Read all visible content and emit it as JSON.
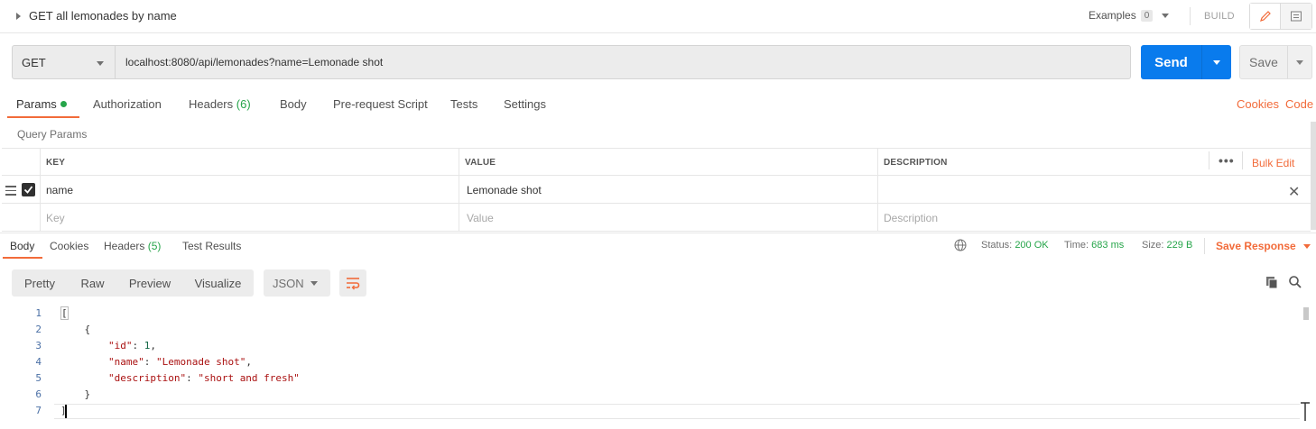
{
  "request": {
    "title": "GET all lemonades by name",
    "examples_label": "Examples",
    "examples_count": "0",
    "build_label": "BUILD",
    "method": "GET",
    "url": "localhost:8080/api/lemonades?name=Lemonade shot",
    "send_label": "Send",
    "save_label": "Save"
  },
  "request_tabs": {
    "params": "Params",
    "authorization": "Authorization",
    "headers": "Headers",
    "headers_count": "(6)",
    "body": "Body",
    "pre_request": "Pre-request Script",
    "tests": "Tests",
    "settings": "Settings",
    "cookies": "Cookies",
    "code": "Code"
  },
  "query_params": {
    "title": "Query Params",
    "columns": [
      "KEY",
      "VALUE",
      "DESCRIPTION"
    ],
    "bulk_edit": "Bulk Edit",
    "rows": [
      {
        "key": "name",
        "value": "Lemonade shot",
        "description": "",
        "enabled": true
      }
    ],
    "placeholder": {
      "key": "Key",
      "value": "Value",
      "description": "Description"
    }
  },
  "response_tabs": {
    "body": "Body",
    "cookies": "Cookies",
    "headers": "Headers",
    "headers_count": "(5)",
    "test_results": "Test Results"
  },
  "response_status": {
    "status_label": "Status:",
    "status_value": "200 OK",
    "time_label": "Time:",
    "time_value": "683 ms",
    "size_label": "Size:",
    "size_value": "229 B",
    "save_response": "Save Response"
  },
  "body_toolbar": {
    "views": [
      "Pretty",
      "Raw",
      "Preview",
      "Visualize"
    ],
    "format": "JSON"
  },
  "response_body": {
    "line_numbers": [
      "1",
      "2",
      "3",
      "4",
      "5",
      "6",
      "7"
    ],
    "json": [
      {
        "id": 1,
        "name": "Lemonade shot",
        "description": "short and fresh"
      }
    ]
  },
  "colors": {
    "accent": "#f26b3a",
    "send": "#097bed",
    "success": "#26a54a"
  }
}
